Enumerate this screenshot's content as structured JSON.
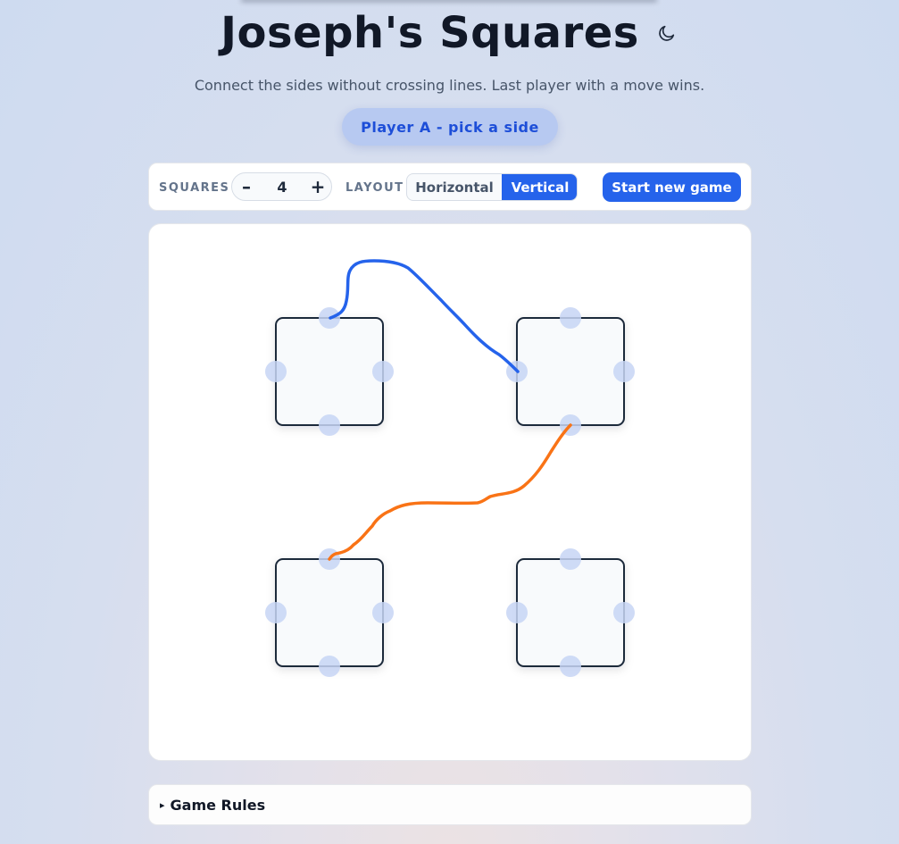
{
  "header": {
    "title": "Joseph's Squares",
    "subtitle": "Connect the sides without crossing lines. Last player with a move wins.",
    "theme_toggle_icon": "moon-icon"
  },
  "status": {
    "text": "Player A - pick a side"
  },
  "controls": {
    "squares_label": "SQUARES",
    "squares_value": "4",
    "minus_label": "–",
    "plus_label": "+",
    "layout_label": "LAYOUT",
    "layout_options": [
      "Horizontal",
      "Vertical"
    ],
    "layout_selected": "Vertical",
    "new_game_label": "Start new game"
  },
  "board": {
    "squares": [
      {
        "id": "square-1",
        "row": 1,
        "col": 1
      },
      {
        "id": "square-2",
        "row": 1,
        "col": 2
      },
      {
        "id": "square-3",
        "row": 2,
        "col": 1
      },
      {
        "id": "square-4",
        "row": 2,
        "col": 2
      }
    ],
    "moves": [
      {
        "player": "blue",
        "from": "square-1-top",
        "to": "square-2-left"
      },
      {
        "player": "orange",
        "from": "square-2-bottom",
        "to": "square-3-top"
      }
    ]
  },
  "rules": {
    "caret": "▸",
    "label": "Game Rules"
  },
  "colors": {
    "accent": "#2563eb",
    "player_blue": "#2563eb",
    "player_orange": "#f97316",
    "square_stroke": "#1e293b",
    "square_fill": "#f8fafc",
    "anchor_fill": "#c7d5f5"
  }
}
